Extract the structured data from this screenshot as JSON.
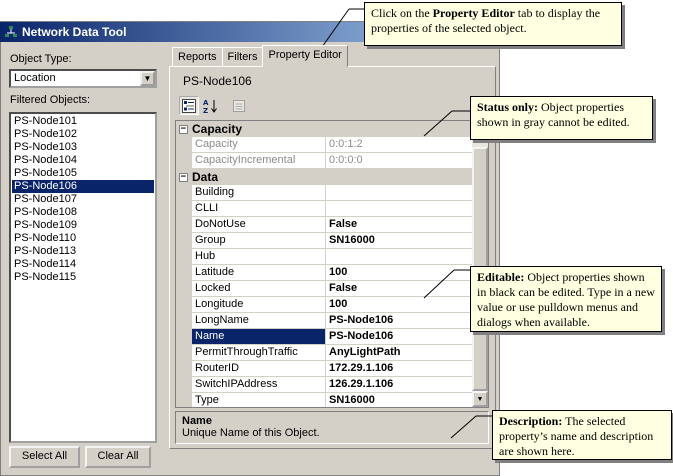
{
  "window": {
    "title": "Network Data Tool"
  },
  "left": {
    "object_type_label": "Object Type:",
    "object_type_value": "Location",
    "filtered_label": "Filtered Objects:",
    "items": [
      "PS-Node101",
      "PS-Node102",
      "PS-Node103",
      "PS-Node104",
      "PS-Node105",
      "PS-Node106",
      "PS-Node107",
      "PS-Node108",
      "PS-Node109",
      "PS-Node110",
      "PS-Node113",
      "PS-Node114",
      "PS-Node115"
    ],
    "selected_index": 5,
    "select_all": "Select All",
    "clear_all": "Clear All"
  },
  "tabs": [
    "Reports",
    "Filters",
    "Property Editor"
  ],
  "editor": {
    "object_name": "PS-Node106",
    "categories": [
      {
        "name": "Capacity",
        "rows": [
          {
            "name": "Capacity",
            "value": "0:0:1:2",
            "readonly": true
          },
          {
            "name": "CapacityIncremental",
            "value": "0:0:0:0",
            "readonly": true
          }
        ]
      },
      {
        "name": "Data",
        "rows": [
          {
            "name": "Building",
            "value": ""
          },
          {
            "name": "CLLI",
            "value": ""
          },
          {
            "name": "DoNotUse",
            "value": "False"
          },
          {
            "name": "Group",
            "value": "SN16000"
          },
          {
            "name": "Hub",
            "value": ""
          },
          {
            "name": "Latitude",
            "value": "100"
          },
          {
            "name": "Locked",
            "value": "False"
          },
          {
            "name": "Longitude",
            "value": "100"
          },
          {
            "name": "LongName",
            "value": "PS-Node106"
          },
          {
            "name": "Name",
            "value": "PS-Node106",
            "selected": true
          },
          {
            "name": "PermitThroughTraffic",
            "value": "AnyLightPath"
          },
          {
            "name": "RouterID",
            "value": "172.29.1.106"
          },
          {
            "name": "SwitchIPAddress",
            "value": "126.29.1.106"
          },
          {
            "name": "Type",
            "value": "SN16000"
          }
        ]
      }
    ],
    "description_title": "Name",
    "description_text": "Unique Name of this Object."
  },
  "callouts": {
    "c1": {
      "pre": "Click on the ",
      "bold": "Property Editor",
      "post": " tab to display the properties of the selected object."
    },
    "c2": {
      "bold": "Status only:",
      "post": " Object properties shown in gray cannot be edited."
    },
    "c3": {
      "bold": "Editable:",
      "post": " Object properties shown in black can be edited.  Type in a new value or use pulldown menus and dialogs when available."
    },
    "c4": {
      "bold": "Description:",
      "post": " The selected property’s name and description are shown here."
    }
  },
  "icons": {
    "app": "network-tree-icon",
    "categorized": "categorized-view-icon",
    "alphabetical": "alphabetical-sort-icon",
    "property_pages": "property-pages-icon",
    "combo_arrow": "chevron-down-icon"
  },
  "colors": {
    "titlebar_start": "#0a246a",
    "titlebar_end": "#a6caf0",
    "selection": "#0a246a",
    "callout_bg": "#ffffe1",
    "readonly_text": "#8c8c8c"
  }
}
